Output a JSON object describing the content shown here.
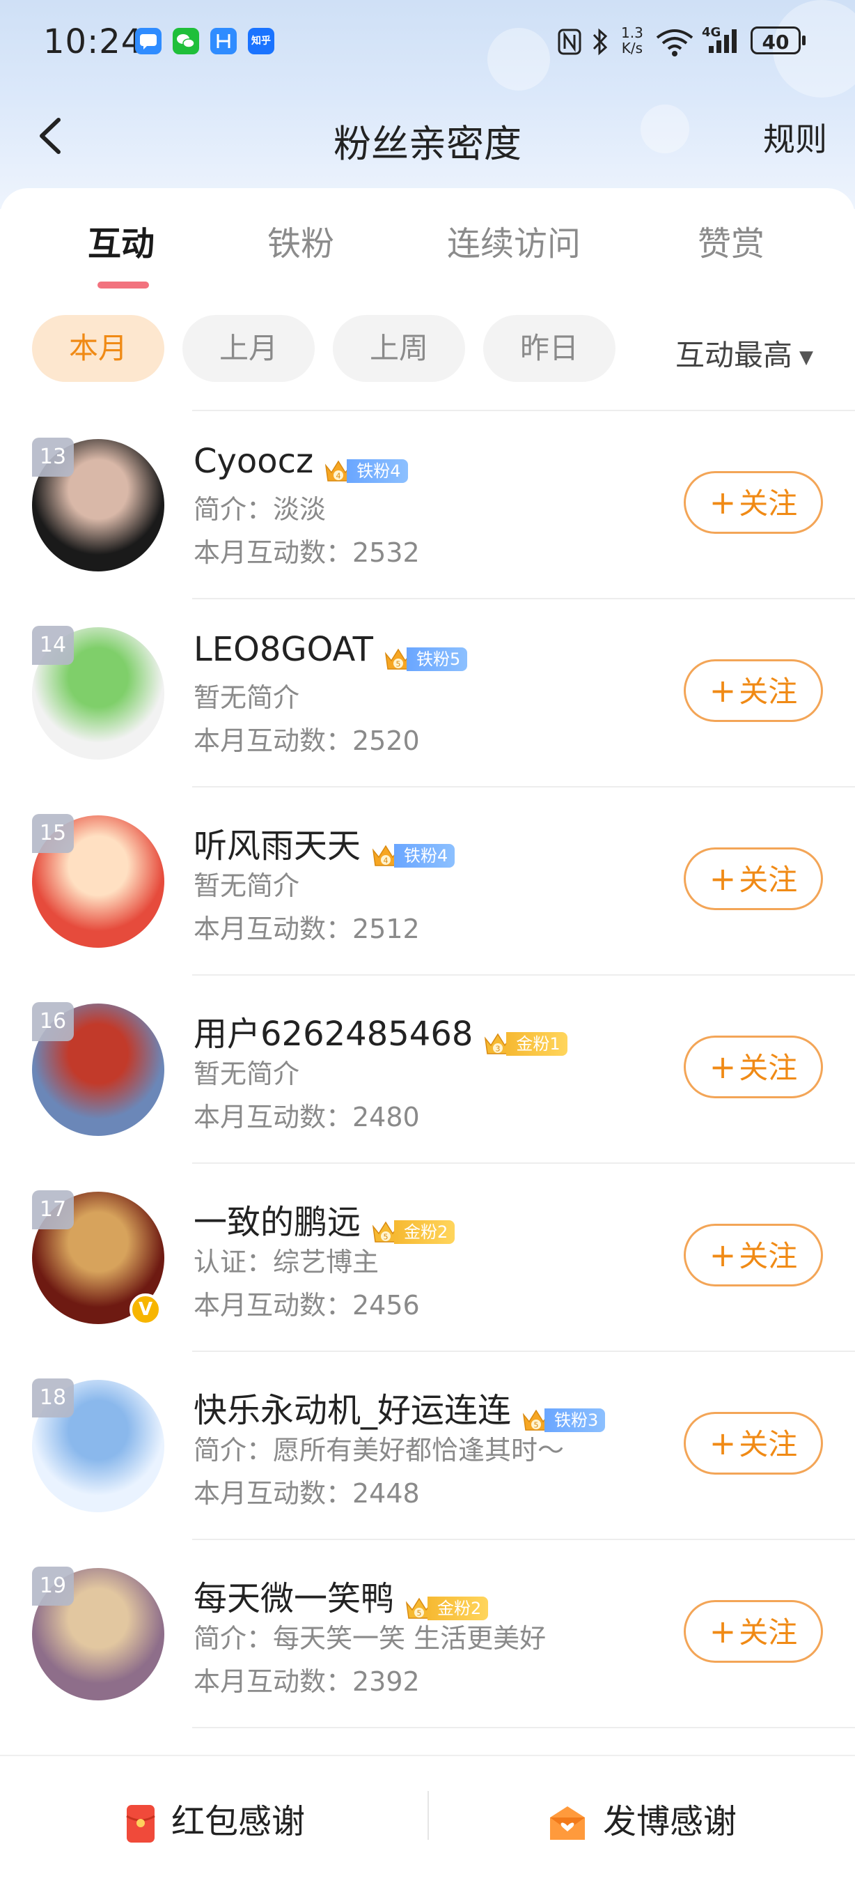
{
  "status_bar": {
    "time": "10:24",
    "net_speed_top": "1.3",
    "net_speed_bottom": "K/s",
    "signal": "4G",
    "battery": "40",
    "notifications": [
      {
        "icon": "message-icon",
        "color": "#2f8cff"
      },
      {
        "icon": "wechat-icon",
        "color": "#1fbf3a"
      },
      {
        "icon": "app-icon",
        "color": "#2f8cff"
      },
      {
        "icon": "zhihu-icon",
        "color": "#1a73ff",
        "text": "知乎"
      }
    ]
  },
  "nav": {
    "title": "粉丝亲密度",
    "rules": "规则"
  },
  "tabs": [
    "互动",
    "铁粉",
    "连续访问",
    "赞赏"
  ],
  "active_tab": 0,
  "filters": [
    "本月",
    "上月",
    "上周",
    "昨日"
  ],
  "active_filter": 0,
  "sort": {
    "label": "互动最高"
  },
  "follow_label": "关注",
  "fans": [
    {
      "rank": "13",
      "name": "Cyoocz",
      "badge_type": "iron",
      "badge_level": "4",
      "badge_text": "铁粉4",
      "desc": "简介：淡淡",
      "count": "本月互动数：2532",
      "verified": false,
      "avatar_colors": [
        "#1a1a1a",
        "#d9b8a8"
      ]
    },
    {
      "rank": "14",
      "name": "LEO8GOAT",
      "badge_type": "iron",
      "badge_level": "5",
      "badge_text": "铁粉5",
      "desc": "暂无简介",
      "count": "本月互动数：2520",
      "verified": false,
      "avatar_colors": [
        "#f2f2f2",
        "#7fcf6a"
      ]
    },
    {
      "rank": "15",
      "name": "听风雨天天",
      "badge_type": "iron",
      "badge_level": "4",
      "badge_text": "铁粉4",
      "desc": "暂无简介",
      "count": "本月互动数：2512",
      "verified": false,
      "avatar_colors": [
        "#e64b3c",
        "#ffe0c2"
      ]
    },
    {
      "rank": "16",
      "name": "用户6262485468",
      "badge_type": "gold",
      "badge_level": "3",
      "badge_text": "金粉1",
      "desc": "暂无简介",
      "count": "本月互动数：2480",
      "verified": false,
      "avatar_colors": [
        "#6b87b8",
        "#c23a2a"
      ]
    },
    {
      "rank": "17",
      "name": "一致的鹏远",
      "badge_type": "gold",
      "badge_level": "5",
      "badge_text": "金粉2",
      "desc": "认证：综艺博主",
      "count": "本月互动数：2456",
      "verified": true,
      "avatar_colors": [
        "#6e1a12",
        "#d7a35c"
      ]
    },
    {
      "rank": "18",
      "name": "快乐永动机_好运连连",
      "badge_type": "iron",
      "badge_level": "5",
      "badge_text": "铁粉3",
      "desc": "简介：愿所有美好都恰逢其时～",
      "count": "本月互动数：2448",
      "verified": false,
      "avatar_colors": [
        "#eaf3ff",
        "#8ab8ec"
      ]
    },
    {
      "rank": "19",
      "name": "每天微一笑鸭",
      "badge_type": "gold",
      "badge_level": "5",
      "badge_text": "金粉2",
      "desc": "简介：每天笑一笑 生活更美好",
      "count": "本月互动数：2392",
      "verified": false,
      "avatar_colors": [
        "#8e6e8a",
        "#e2c7a0"
      ]
    }
  ],
  "bottom_bar": {
    "left_label": "红包感谢",
    "right_label": "发博感谢"
  },
  "colors": {
    "accent_orange": "#f08a15",
    "tab_indicator": "#f2727e",
    "iron_badge": "#6aa6ff",
    "gold_badge": "#f6b932"
  }
}
